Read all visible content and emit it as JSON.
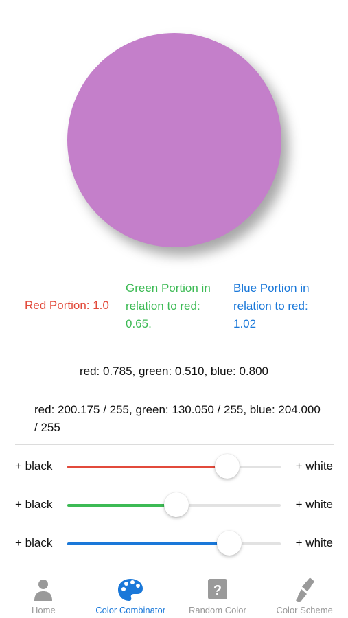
{
  "colors": {
    "swatch": "#c47fca",
    "red": "#e24a3b",
    "green": "#3cba54",
    "blue": "#1a78d9",
    "tab_active": "#1a78d9",
    "tab_inactive": "#9a9a9a"
  },
  "portions": {
    "red": "Red Portion: 1.0",
    "green": "Green Portion in relation to red: 0.65.",
    "blue": "Blue Portion in relation to red: 1.02"
  },
  "values_normalized": "red: 0.785, green: 0.510, blue: 0.800",
  "values_255": "red: 200.175 / 255, green: 130.050 / 255, blue: 204.000 / 255",
  "sliders": [
    {
      "name": "red",
      "left_label": "+ black",
      "right_label": "+ white",
      "value": 0.75,
      "color": "#e24a3b"
    },
    {
      "name": "green",
      "left_label": "+ black",
      "right_label": "+ white",
      "value": 0.51,
      "color": "#3cba54"
    },
    {
      "name": "blue",
      "left_label": "+ black",
      "right_label": "+ white",
      "value": 0.76,
      "color": "#1a78d9"
    }
  ],
  "tabs": [
    {
      "label": "Home",
      "icon": "person-icon",
      "active": false
    },
    {
      "label": "Color Combinator",
      "icon": "palette-icon",
      "active": true
    },
    {
      "label": "Random Color",
      "icon": "question-box-icon",
      "active": false
    },
    {
      "label": "Color Scheme",
      "icon": "paint-brush-icon",
      "active": false
    }
  ]
}
